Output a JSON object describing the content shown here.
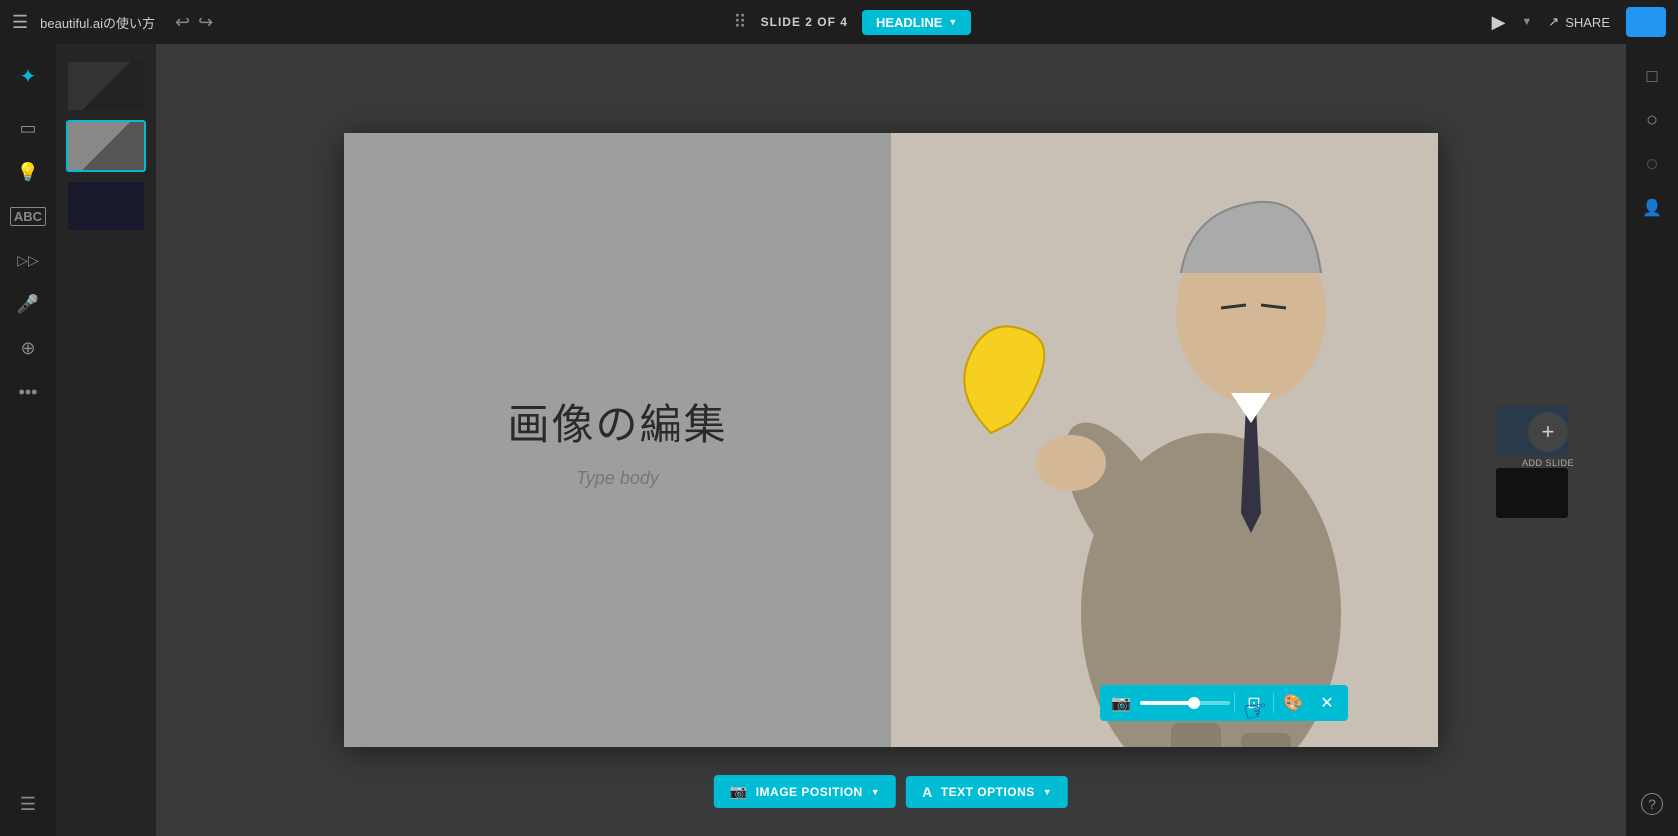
{
  "app": {
    "title": "beautiful.aiの使い方",
    "slide_indicator": "SLIDE 2 OF 4",
    "headline_btn": "HEADLINE",
    "share_label": "SHARE",
    "upgrade_label": ""
  },
  "toolbar": {
    "undo_symbol": "↩",
    "redo_symbol": "↪",
    "play_symbol": "▶",
    "share_icon": "↗",
    "grid_icon": "⠿"
  },
  "slide": {
    "title": "画像の編集",
    "body_placeholder": "Type body"
  },
  "bottom_toolbar": {
    "image_position_label": "IMAGE POSITION",
    "text_options_label": "TEXT OPTIONS"
  },
  "add_slide": {
    "label": "ADD SLIDE",
    "icon": "+"
  },
  "sidebar": {
    "logo_dots": "✦",
    "icons": [
      {
        "name": "slides-icon",
        "symbol": "▭"
      },
      {
        "name": "bulb-icon",
        "symbol": "💡"
      },
      {
        "name": "text-icon",
        "symbol": "A"
      },
      {
        "name": "animation-icon",
        "symbol": "▷▷"
      },
      {
        "name": "mic-icon",
        "symbol": "🎤"
      },
      {
        "name": "cursor-icon",
        "symbol": "⊕"
      },
      {
        "name": "more-icon",
        "symbol": "•••"
      }
    ],
    "bottom_icon": {
      "name": "notes-icon",
      "symbol": "☰"
    }
  },
  "right_sidebar": {
    "icons": [
      {
        "name": "chat-icon",
        "symbol": "□"
      },
      {
        "name": "account-icon",
        "symbol": "○"
      },
      {
        "name": "dashed-circle-icon",
        "symbol": "◌"
      },
      {
        "name": "person-add-icon",
        "symbol": "👤+"
      },
      {
        "name": "help-icon",
        "symbol": "?"
      }
    ]
  },
  "image_toolbar": {
    "camera_icon": "📷",
    "slider_value": 60,
    "crop_icon": "⊡",
    "palette_icon": "🎨",
    "close_icon": "✕"
  },
  "colors": {
    "accent": "#00bcd4",
    "topbar_bg": "#1e1e1e",
    "sidebar_bg": "#1e1e1e",
    "canvas_bg": "#3a3a3a",
    "slide_left_bg": "#9e9e9e",
    "upgrade_btn": "#2196F3"
  }
}
